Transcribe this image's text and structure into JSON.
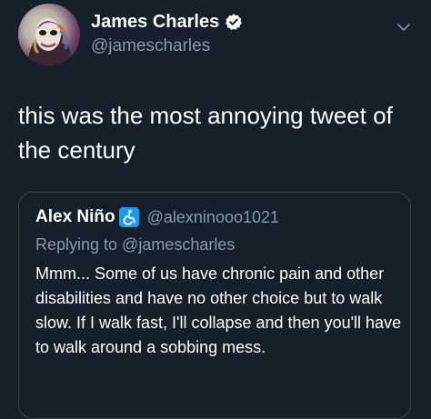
{
  "tweet": {
    "author": {
      "name": "James Charles",
      "handle": "@jamescharles",
      "verified": true,
      "avatar_icon": "avatar-makeup-portrait"
    },
    "menu_icon": "chevron-down-icon",
    "text": "this was the most annoying tweet of the century"
  },
  "quoted_tweet": {
    "author": {
      "name": "Alex Niño",
      "handle": "@alexninooo1021",
      "badge_icon": "accessibility-icon"
    },
    "replying_to": "Replying to @jamescharles",
    "text": "Mmm... Some of us have chronic pain and other disabilities and have no other choice but to walk slow. If I walk fast, I'll collapse and then you'll have to walk around a sobbing mess."
  },
  "colors": {
    "background": "#15202b",
    "primary_text": "#ffffff",
    "secondary_text": "#8899a6",
    "border": "#38444d",
    "verified_badge": "#ffffff",
    "accessibility_badge": "#1d9bf0"
  }
}
